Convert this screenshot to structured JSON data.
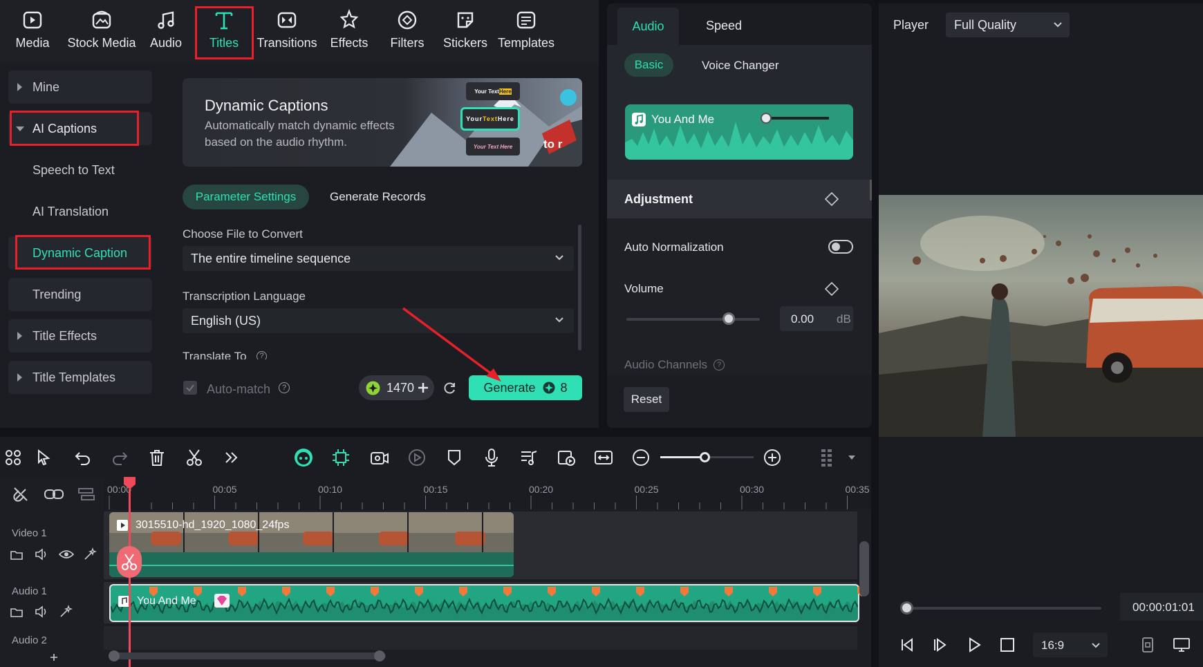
{
  "toolbar": {
    "tabs": [
      {
        "label": "Media",
        "icon": "media-icon"
      },
      {
        "label": "Stock Media",
        "icon": "stock-media-icon"
      },
      {
        "label": "Audio",
        "icon": "music-note-icon"
      },
      {
        "label": "Titles",
        "icon": "titles-t-icon"
      },
      {
        "label": "Transitions",
        "icon": "transitions-icon"
      },
      {
        "label": "Effects",
        "icon": "effects-star-icon"
      },
      {
        "label": "Filters",
        "icon": "filters-icon"
      },
      {
        "label": "Stickers",
        "icon": "stickers-icon"
      },
      {
        "label": "Templates",
        "icon": "templates-icon"
      }
    ],
    "active": "Titles"
  },
  "left_panel": {
    "items": [
      {
        "label": "Mine"
      },
      {
        "label": "AI Captions"
      },
      {
        "label": "Speech to Text"
      },
      {
        "label": "AI Translation"
      },
      {
        "label": "Dynamic Caption"
      },
      {
        "label": "Trending"
      },
      {
        "label": "Title Effects"
      },
      {
        "label": "Title Templates"
      }
    ],
    "selected": "Dynamic Caption"
  },
  "banner": {
    "title": "Dynamic Captions",
    "desc_line1": "Automatically match dynamic effects",
    "desc_line2": "based on the audio rhythm.",
    "card1_a": "Your Text ",
    "card1_b": "Here",
    "card2_a": "Your ",
    "card2_b": "Text",
    "card2_c": " Here",
    "card3": "Your Text Here",
    "overlay_text": "to r"
  },
  "params": {
    "tab_active": "Parameter Settings",
    "tab_other": "Generate Records",
    "file_label": "Choose File to Convert",
    "file_value": "The entire timeline sequence",
    "lang_label": "Transcription Language",
    "lang_value": "English (US)",
    "translate_label": "Translate To",
    "auto_match": "Auto-match",
    "credits": "1470",
    "generate": "Generate",
    "generate_cost": "8"
  },
  "audio_panel": {
    "tabs": [
      "Audio",
      "Speed"
    ],
    "subtabs": [
      "Basic",
      "Voice Changer"
    ],
    "clip_name": "You And Me",
    "adjustment": "Adjustment",
    "auto_normalization": "Auto Normalization",
    "auto_normalization_on": false,
    "volume_label": "Volume",
    "volume_value": "0.00",
    "volume_unit": "dB",
    "audio_channels": "Audio Channels",
    "reset": "Reset"
  },
  "player": {
    "label": "Player",
    "quality": "Full Quality",
    "timecode": "00:00:01:01",
    "aspect": "16:9"
  },
  "timeline": {
    "ruler": [
      "00:00",
      "00:05",
      "00:10",
      "00:15",
      "00:20",
      "00:25",
      "00:30",
      "00:35"
    ],
    "tracks": {
      "video1": "Video 1",
      "audio1": "Audio 1",
      "audio2": "Audio 2"
    },
    "video_clip": "3015510-hd_1920_1080_24fps",
    "audio_clip": "You And Me"
  },
  "colors": {
    "accent": "#2fe0b5",
    "highlight_red": "#e8202a",
    "playhead": "#f04a5a",
    "audio_wave": "#2fb895"
  }
}
